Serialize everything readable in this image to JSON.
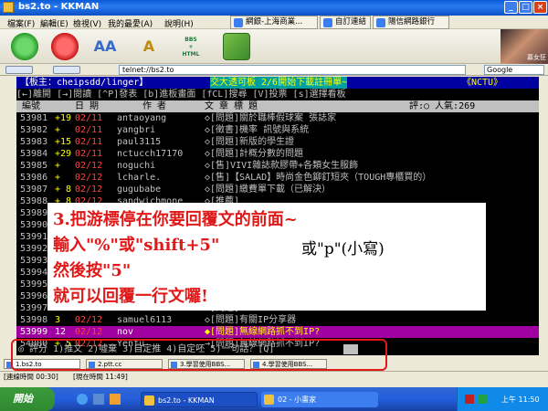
{
  "window": {
    "title": "bs2.to - KKMAN",
    "minimize": "_",
    "maximize": "□",
    "close": "×"
  },
  "menu": [
    "檔案(F)",
    "編輯(E)",
    "檢視(V)",
    "我的最愛(A)",
    "說明(H)"
  ],
  "top_tabs": [
    "網銀-上海商業...",
    "自訂連結",
    "陽信網路銀行"
  ],
  "toolbar": {
    "go_icon": "go-icon",
    "stop_icon": "stop-icon",
    "bbs_html_label": "BBS\n+\nHTML"
  },
  "address": {
    "url": "telnet://bs2.to",
    "search_placeholder": "Google",
    "chip1": "",
    "chip2": ""
  },
  "photo": {
    "caption": "慕女狂"
  },
  "terminal": {
    "header_left": "【板主：cheipsdd/linger】",
    "header_mid": "交大透可板 2/6開始下載註冊單~",
    "header_right": "《NCTU》",
    "keys": "[←]離開 [→]閱讀 [^P]發表 [b]進板畫面 [fCL]搜尋 [V]投票 [s]選擇看板",
    "columns": {
      "num": "編號",
      "date": "日 期",
      "author": "作 者",
      "title": "文 章 標 題",
      "extra": "評:○ 人氣:269"
    },
    "rows": [
      {
        "num": "53981",
        "mark": "+19",
        "date": "02/11",
        "author": "antaoyang",
        "title": "◇[問題]關於職棒假球案 張誌家"
      },
      {
        "num": "53982",
        "mark": "+",
        "date": "02/11",
        "author": "yangbri",
        "title": "◇[徵書]機率 訊號與系統"
      },
      {
        "num": "53983",
        "mark": "+15",
        "date": "02/11",
        "author": "paul3115",
        "title": "◇[問題]新版的學生證"
      },
      {
        "num": "53984",
        "mark": "+29",
        "date": "02/11",
        "author": "nctucch17170",
        "title": "◇[問題]計概分數的問題"
      },
      {
        "num": "53985",
        "mark": "+",
        "date": "02/12",
        "author": "noguchi",
        "title": "◇[售]VIVI雜誌款膠帶+各類女生服飾"
      },
      {
        "num": "53986",
        "mark": "+",
        "date": "02/12",
        "author": "lcharle.",
        "title": "◇[售]【SALAD】時尚金色鉚釘短夾（TOUGH專櫃買的）"
      },
      {
        "num": "53987",
        "mark": "+ 8",
        "date": "02/12",
        "author": "gugubabe",
        "title": "◇[問題]繳費單下載（已解決）"
      },
      {
        "num": "53988",
        "mark": "+ 8",
        "date": "02/12",
        "author": "sandwichmone",
        "title": "◇[推薦]"
      },
      {
        "num": "53989",
        "mark": "",
        "date": "",
        "author": "",
        "title": ""
      },
      {
        "num": "53990",
        "mark": "",
        "date": "",
        "author": "",
        "title": ""
      },
      {
        "num": "53991",
        "mark": "",
        "date": "",
        "author": "",
        "title": ""
      },
      {
        "num": "53992",
        "mark": "",
        "date": "",
        "author": "",
        "title": ""
      },
      {
        "num": "53993",
        "mark": "",
        "date": "",
        "author": "",
        "title": ""
      },
      {
        "num": "53994",
        "mark": "",
        "date": "",
        "author": "",
        "title": ""
      },
      {
        "num": "53995",
        "mark": "",
        "date": "",
        "author": "",
        "title": ""
      },
      {
        "num": "53996",
        "mark": "",
        "date": "",
        "author": "",
        "title": ""
      },
      {
        "num": "53997",
        "mark": "",
        "date": "02/12",
        "author": "karuebo",
        "title": "◇[問題]"
      },
      {
        "num": "53998",
        "mark": "3",
        "date": "02/12",
        "author": "samuel6113",
        "title": "◇[問題]有關IP分享器"
      },
      {
        "num": "53999",
        "mark": "12",
        "date": "02/12",
        "author": "nov",
        "title": "◆[問題]無線網路抓不到IP?"
      },
      {
        "num": "54000",
        "mark": "+ 5",
        "date": "02/12",
        "author": "Yenfu",
        "title": "→[問題]無線網路抓不到IP?"
      }
    ],
    "prompt": "◎ 評分 1)推文 2)噓棄 3)自定推 4)自定呸 5)一句話？[Q]"
  },
  "overlay": {
    "line1": "3.把游標停在你要回覆文的前面~",
    "line2": "輸入\"%\"或\"shift+5\"",
    "aside": "或\"p\"(小寫)",
    "line3": "然後按\"5\"",
    "line4": "就可以回覆一行文囉!"
  },
  "bottom_tabs": [
    "1.bs2.to",
    "2.ptt.cc",
    "3.學習使用BBS...",
    "4.學習使用BBS..."
  ],
  "status": {
    "conn_time": "[連線時間 00:30]",
    "now_time": "[現在時間 11:49]"
  },
  "taskbar": {
    "start": "開始",
    "items": [
      "bs2.to - KKMAN",
      "02 - 小畫家"
    ],
    "clock": "上午 11:50"
  },
  "colors": {
    "overlay_red": "#e01818",
    "title_blue": "#0a5bd6",
    "header_cyan": "#00c0c0",
    "selected_row": "#a000a0"
  }
}
